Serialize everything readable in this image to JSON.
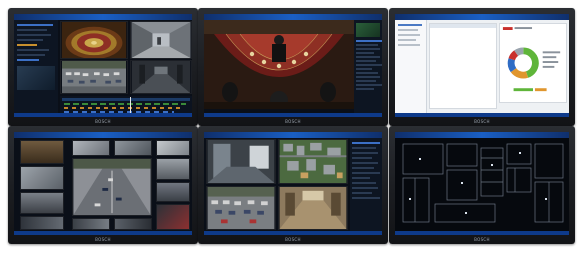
{
  "monitors": [
    {
      "position": "top-left",
      "content": "casino-surveillance-client",
      "brand": "BOSCH"
    },
    {
      "position": "top-center",
      "content": "gaming-table-overhead-camera",
      "brand": "BOSCH"
    },
    {
      "position": "top-right",
      "content": "system-health-dashboard",
      "brand": "BOSCH"
    },
    {
      "position": "bottom-left",
      "content": "multi-camera-grid",
      "brand": "BOSCH"
    },
    {
      "position": "bottom-center",
      "content": "quad-camera-view",
      "brand": "BOSCH"
    },
    {
      "position": "bottom-right",
      "content": "floor-plan-map",
      "brand": "BOSCH"
    }
  ],
  "colors": {
    "bezel": "#1b1d21",
    "app_titlebar": "#1a5fc4",
    "felt_green": "#2f6a3a",
    "roulette_red": "#8e2f24",
    "status_green": "#5fb53a",
    "status_orange": "#e0962e"
  },
  "dashboard": {
    "donut_segments": [
      0.45,
      0.2,
      0.15,
      0.1,
      0.1
    ]
  }
}
